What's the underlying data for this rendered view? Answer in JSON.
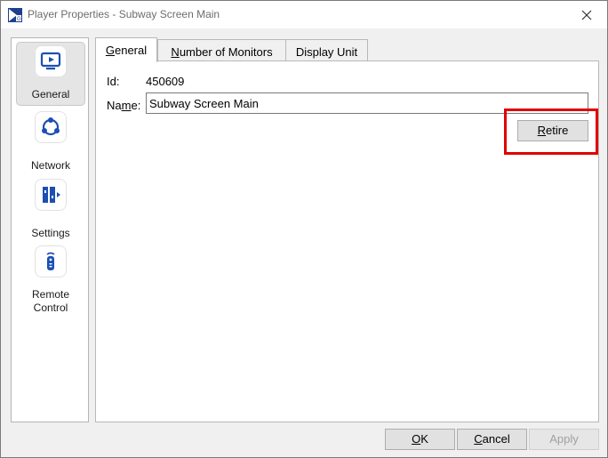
{
  "window": {
    "title": "Player Properties - Subway Screen Main",
    "close_icon": "close-icon"
  },
  "sidebar": {
    "items": [
      {
        "label": "General",
        "icon": "monitor-play-icon",
        "active": true
      },
      {
        "label": "Network",
        "icon": "network-icon",
        "active": false
      },
      {
        "label": "Settings",
        "icon": "settings-panel-icon",
        "active": false
      },
      {
        "label": "Remote Control",
        "icon": "remote-control-icon",
        "active": false
      }
    ]
  },
  "tabs": [
    {
      "accel": "G",
      "rest": "eneral",
      "active": true
    },
    {
      "accel": "N",
      "rest": "umber of Monitors",
      "active": false
    },
    {
      "accel": "",
      "rest": "Display Unit",
      "active": false
    }
  ],
  "general": {
    "id_label": "Id:",
    "id_value": "450609",
    "name_label_pre": "Na",
    "name_label_accel": "m",
    "name_label_post": "e:",
    "name_value": "Subway Screen Main",
    "retire_accel": "R",
    "retire_rest": "etire"
  },
  "footer": {
    "ok_accel": "O",
    "ok_rest": "K",
    "cancel_accel": "C",
    "cancel_rest": "ancel",
    "apply_label": "Apply"
  },
  "colors": {
    "accent": "#1b4fb3",
    "highlight": "#e00000"
  }
}
